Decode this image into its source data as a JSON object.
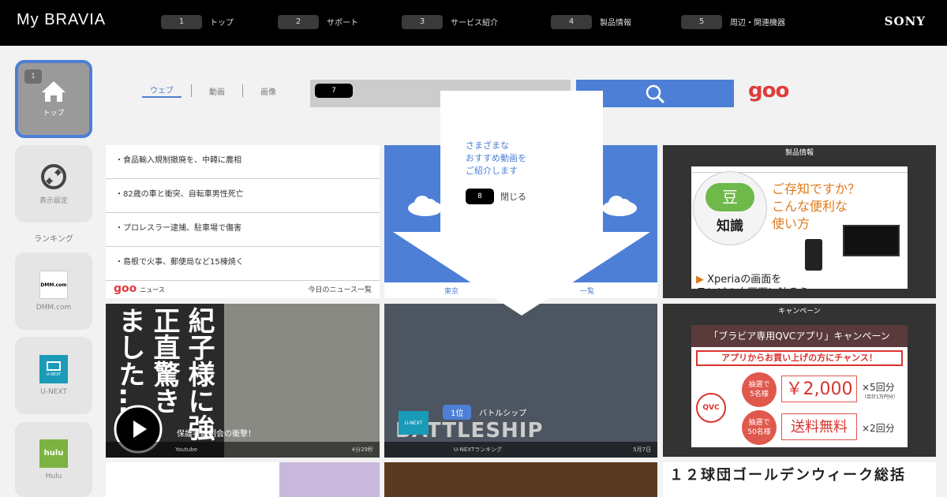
{
  "app": {
    "title": "My BRAVIA",
    "brand": "SONY"
  },
  "nav": [
    {
      "num": "1",
      "label": "トップ"
    },
    {
      "num": "2",
      "label": "サポート"
    },
    {
      "num": "3",
      "label": "サービス紹介"
    },
    {
      "num": "4",
      "label": "製品情報"
    },
    {
      "num": "5",
      "label": "周辺・関連機器"
    }
  ],
  "sidebar": {
    "home": {
      "badge": "1",
      "label": "トップ"
    },
    "settings": {
      "label": "表示設定"
    },
    "ranking_label": "ランキング",
    "items": [
      {
        "label": "DMM.com",
        "logo": "DMM.com"
      },
      {
        "label": "U-NEXT",
        "logo": "U-NEXT"
      },
      {
        "label": "Hulu",
        "logo": "hulu"
      }
    ]
  },
  "search": {
    "tabs": [
      "ウェブ",
      "動画",
      "画像"
    ],
    "active_tab": "ウェブ",
    "key_hint": "7",
    "provider": "goo"
  },
  "news": {
    "items": [
      "・食品輸入規制撤廃を、中韓に農相",
      "・82歳の車と衝突、自転車男性死亡",
      "・プロレスラー逮捕、駐車場で傷害",
      "・島根で火事、郵便局など15棟焼く"
    ],
    "brand": "goo",
    "brand_sub": "ニュース",
    "more": "今日のニュース一覧"
  },
  "weather": {
    "left": "東京",
    "right": "一覧"
  },
  "product": {
    "header": "製品情報",
    "ad_title": "ご存知ですか？\nこんな便利な\n使い方",
    "badge_top": "豆",
    "badge_bottom": "知識",
    "ad_caption": "Xperiaの画面を\nテレビの大画面に映そう"
  },
  "campaign": {
    "header": "キャンペーン",
    "title": "「ブラビア専用QVCアプリ」キャンペーン",
    "subtitle": "アプリからお買い上げの方にチャンス！",
    "brand": "QVC",
    "prize1": {
      "tag": "抽選で\n5名様",
      "value": "￥2,000",
      "count": "×5回分",
      "note": "（合計1万円分）"
    },
    "prize2": {
      "tag": "抽選で\n50名様",
      "value": "送料無料",
      "count": "×2回分"
    }
  },
  "video1": {
    "headline": "紀子様に強\n正直驚き\nました…",
    "caption": "保護者説明会の衝撃！",
    "source": "Youtube",
    "duration": "4分29秒"
  },
  "video2": {
    "rank": "1位",
    "title": "バトルシップ",
    "provider": "U-NEXT",
    "source": "U-NEXTランキング",
    "date": "5月7日",
    "logo_text": "BATTLESHIP"
  },
  "tile5": {
    "title": "１２球団ゴールデンウィーク総括"
  },
  "popup": {
    "text": "さまざまな\nおすすめ動画を\nご紹介します",
    "key": "8",
    "close": "閉じる"
  }
}
